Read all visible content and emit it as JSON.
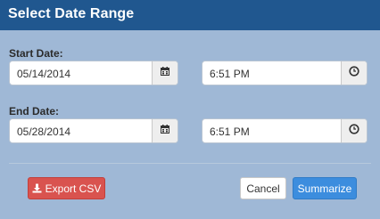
{
  "dialog": {
    "title": "Select Date Range"
  },
  "start": {
    "label": "Start Date:",
    "date_value": "05/14/2014",
    "time_value": "6:51 PM"
  },
  "end": {
    "label": "End Date:",
    "date_value": "05/28/2014",
    "time_value": "6:51 PM"
  },
  "icons": {
    "date": "calendar-icon",
    "time": "clock-icon",
    "export": "download-icon"
  },
  "buttons": {
    "export_label": "Export CSV",
    "cancel_label": "Cancel",
    "submit_label": "Summarize"
  },
  "colors": {
    "header": "#20578f",
    "body": "#9fb8d6",
    "danger": "#d9534f",
    "primary": "#3c8dde"
  }
}
